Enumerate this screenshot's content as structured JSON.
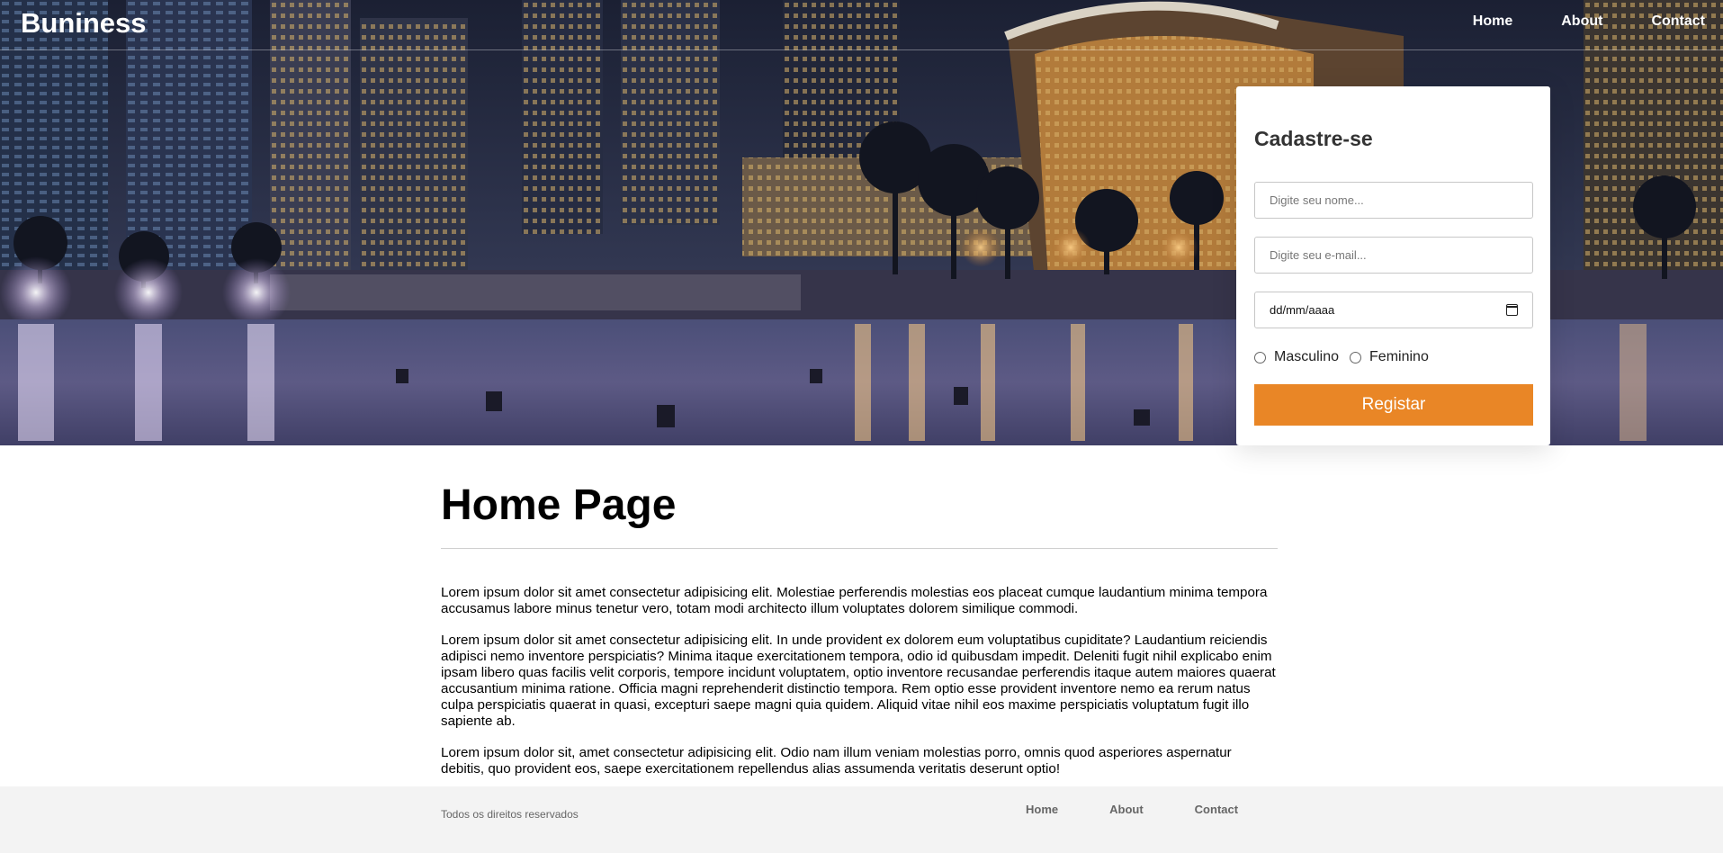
{
  "header": {
    "brand": "Buniness",
    "nav": [
      "Home",
      "About",
      "Contact"
    ]
  },
  "form": {
    "title": "Cadastre-se",
    "name_placeholder": "Digite seu nome...",
    "email_placeholder": "Digite seu e-mail...",
    "date_placeholder": "dd/mm/aaaa",
    "gender_options": [
      "Masculino",
      "Feminino"
    ],
    "submit_label": "Registar"
  },
  "main": {
    "title": "Home Page",
    "paragraphs": [
      "Lorem ipsum dolor sit amet consectetur adipisicing elit. Molestiae perferendis molestias eos placeat cumque laudantium minima tempora accusamus labore minus tenetur vero, totam modi architecto illum voluptates dolorem similique commodi.",
      "Lorem ipsum dolor sit amet consectetur adipisicing elit. In unde provident ex dolorem eum voluptatibus cupiditate? Laudantium reiciendis adipisci nemo inventore perspiciatis? Minima itaque exercitationem tempora, odio id quibusdam impedit. Deleniti fugit nihil explicabo enim ipsam libero quas facilis velit corporis, tempore incidunt voluptatem, optio inventore recusandae perferendis itaque autem maiores quaerat accusantium minima ratione. Officia magni reprehenderit distinctio tempora. Rem optio esse provident inventore nemo ea rerum natus culpa perspiciatis quaerat in quasi, excepturi saepe magni quia quidem. Aliquid vitae nihil eos maxime perspiciatis voluptatum fugit illo sapiente ab.",
      "Lorem ipsum dolor sit, amet consectetur adipisicing elit. Odio nam illum veniam molestias porro, omnis quod asperiores aspernatur debitis, quo provident eos, saepe exercitationem repellendus alias assumenda veritatis deserunt optio!"
    ]
  },
  "footer": {
    "copyright": "Todos os direitos reservados",
    "nav": [
      "Home",
      "About",
      "Contact"
    ]
  },
  "colors": {
    "accent": "#e98626",
    "footer_bg": "#f3f3f3"
  }
}
